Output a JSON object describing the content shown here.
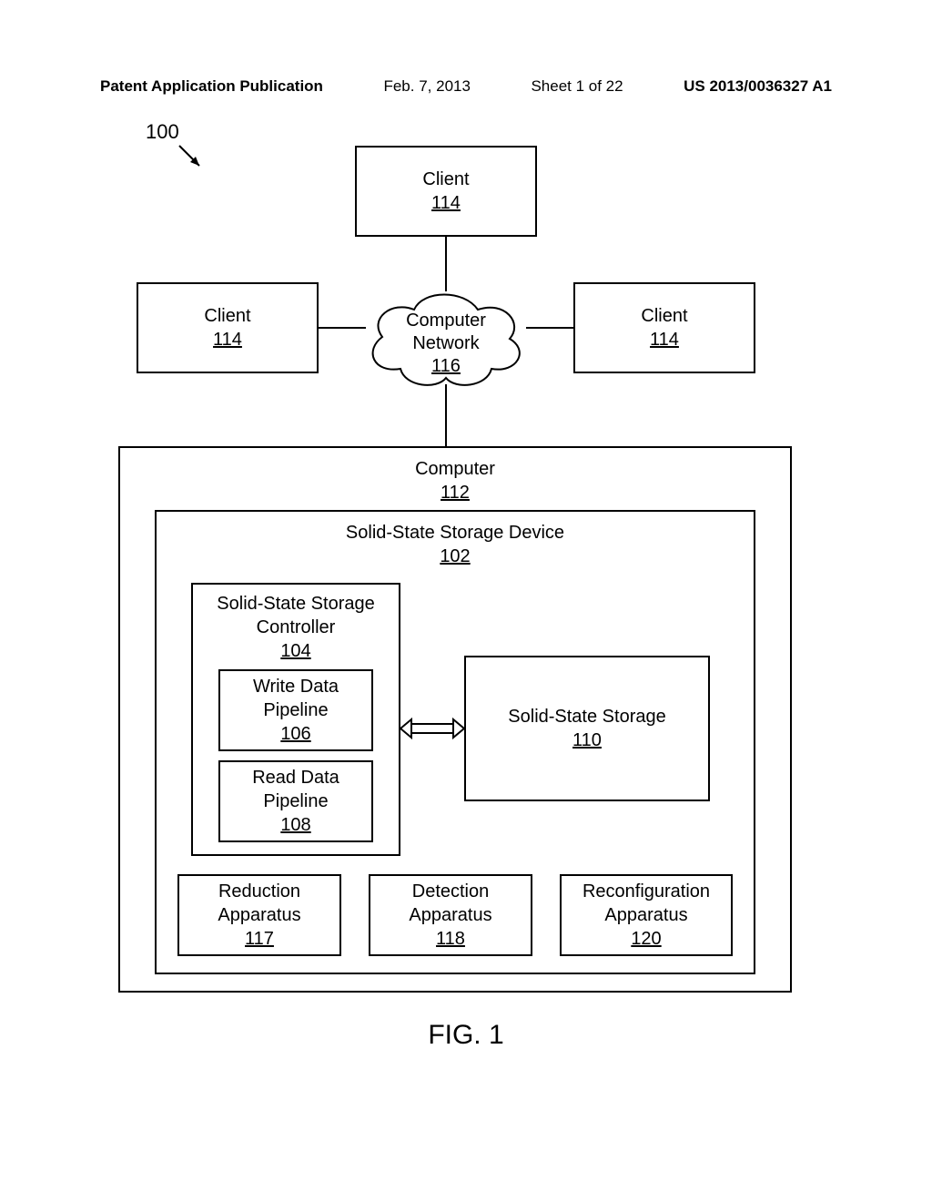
{
  "header": {
    "publication": "Patent Application Publication",
    "date": "Feb. 7, 2013",
    "sheet": "Sheet 1 of 22",
    "docnum": "US 2013/0036327 A1"
  },
  "refnum": "100",
  "clientTop": {
    "label": "Client",
    "num": "114"
  },
  "clientLeft": {
    "label": "Client",
    "num": "114"
  },
  "clientRight": {
    "label": "Client",
    "num": "114"
  },
  "network": {
    "label1": "Computer",
    "label2": "Network",
    "num": "116"
  },
  "computer": {
    "label": "Computer",
    "num": "112"
  },
  "ssd": {
    "label": "Solid-State Storage Device",
    "num": "102"
  },
  "controller": {
    "label1": "Solid-State Storage",
    "label2": "Controller",
    "num": "104"
  },
  "writePipe": {
    "label1": "Write Data",
    "label2": "Pipeline",
    "num": "106"
  },
  "readPipe": {
    "label1": "Read Data",
    "label2": "Pipeline",
    "num": "108"
  },
  "storage": {
    "label": "Solid-State Storage",
    "num": "110"
  },
  "reduction": {
    "label1": "Reduction",
    "label2": "Apparatus",
    "num": "117"
  },
  "detection": {
    "label1": "Detection",
    "label2": "Apparatus",
    "num": "118"
  },
  "reconfig": {
    "label1": "Reconfiguration",
    "label2": "Apparatus",
    "num": "120"
  },
  "figcaption": "FIG. 1"
}
